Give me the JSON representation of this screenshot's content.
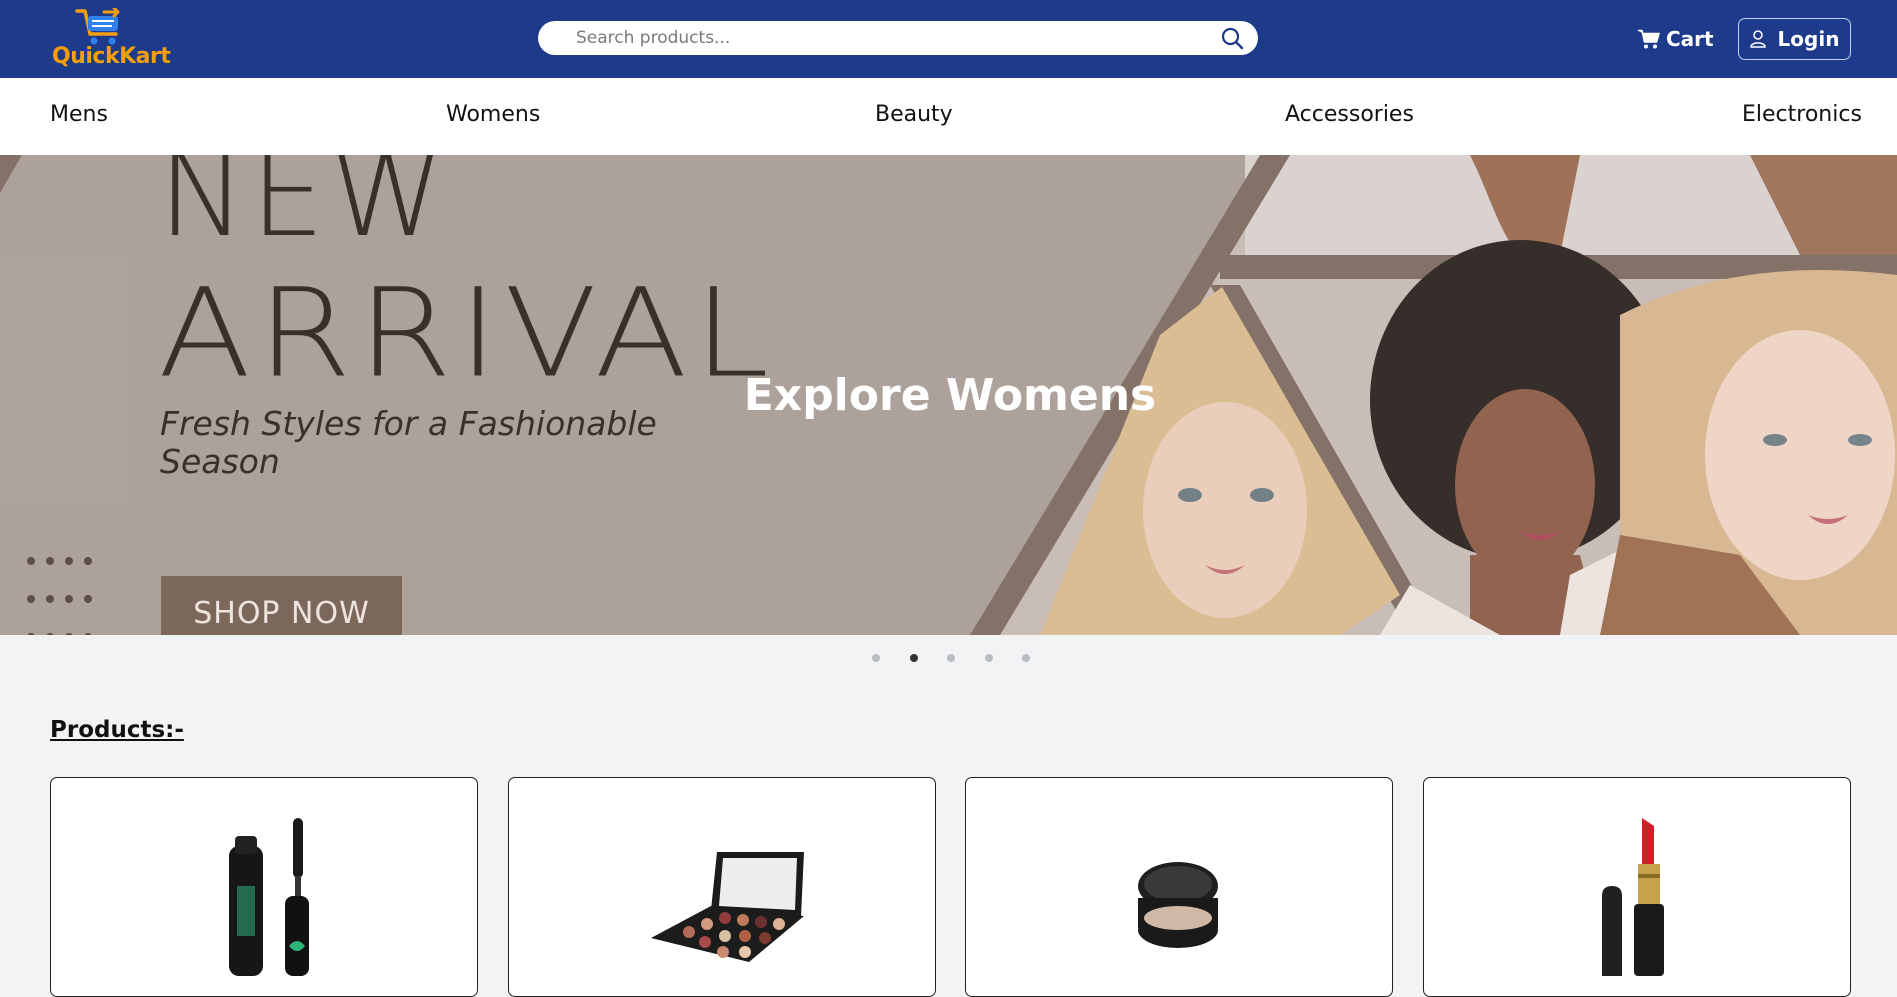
{
  "header": {
    "logo_text": "QuickKart",
    "search": {
      "placeholder": "Search products...",
      "value": ""
    },
    "cart_label": "Cart",
    "login_label": "Login",
    "colors": {
      "background": "#1e3a8a",
      "logo": "#f59e0b"
    }
  },
  "categories": [
    {
      "label": "Mens"
    },
    {
      "label": "Womens"
    },
    {
      "label": "Beauty"
    },
    {
      "label": "Accessories"
    },
    {
      "label": "Electronics"
    }
  ],
  "banner": {
    "overlay_title": "Explore Womens",
    "headline_1": "NEW",
    "headline_2": "ARRIVAL",
    "subtitle": "Fresh Styles for a Fashionable Season",
    "cta": "SHOP NOW",
    "slide_count": 5,
    "active_slide": 2
  },
  "products": {
    "title": "Products:-",
    "items": [
      {
        "icon": "mascara-icon"
      },
      {
        "icon": "eyeshadow-palette-icon"
      },
      {
        "icon": "compact-powder-icon"
      },
      {
        "icon": "lipstick-icon"
      }
    ]
  }
}
